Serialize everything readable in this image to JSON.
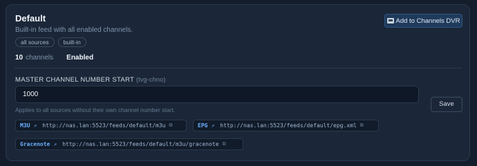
{
  "feed": {
    "title": "Default",
    "subtitle": "Built-in feed with all enabled channels.",
    "tags": [
      "all sources",
      "built-in"
    ],
    "channel_count": "10",
    "channel_label": "channels",
    "status": "Enabled"
  },
  "actions": {
    "add_dvr_label": "Add to Channels DVR",
    "add_dvr_icon": "tv-icon",
    "save_label": "Save"
  },
  "master_channel": {
    "label": "MASTER CHANNEL NUMBER START",
    "hint": "(tvg-chno)",
    "value": "1000",
    "help": "Applies to all sources without their own channel number start."
  },
  "links": [
    {
      "kind": "M3U",
      "url": "http://nas.lan:5523/feeds/default/m3u"
    },
    {
      "kind": "EPG",
      "url": "http://nas.lan:5523/feeds/default/epg.xml"
    },
    {
      "kind": "Gracenote",
      "url": "http://nas.lan:5523/feeds/default/m3u/gracenote"
    }
  ],
  "icons": {
    "external": "arrow-up-right-icon",
    "copy": "copy-icon"
  },
  "colors": {
    "background": "#141d2b",
    "card": "#1b2738",
    "accent": "#6bb1ff",
    "primary_button": "#1f3a5b"
  }
}
